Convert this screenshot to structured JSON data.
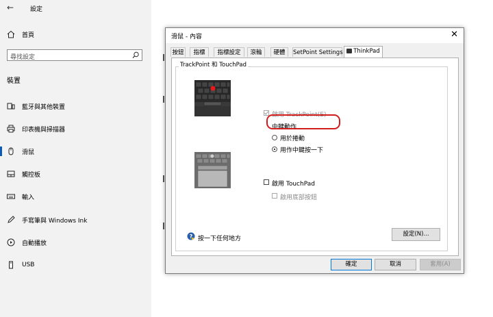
{
  "settings": {
    "window_title": "設定",
    "search": {
      "placeholder": "尋找設定"
    },
    "home_label": "首頁",
    "section_title": "裝置",
    "nav_items": [
      {
        "label": "藍牙與其他裝置",
        "icon": "bluetooth-devices-icon"
      },
      {
        "label": "印表機與掃描器",
        "icon": "printer-icon"
      },
      {
        "label": "滑鼠",
        "icon": "mouse-icon"
      },
      {
        "label": "觸控板",
        "icon": "touchpad-icon"
      },
      {
        "label": "輸入",
        "icon": "keyboard-icon"
      },
      {
        "label": "手寫筆與 Windows Ink",
        "icon": "pen-icon"
      },
      {
        "label": "自動播放",
        "icon": "autoplay-icon"
      },
      {
        "label": "USB",
        "icon": "usb-icon"
      }
    ],
    "active_index": 2,
    "accent_color": "#0a5bb5"
  },
  "dialog": {
    "title": "滑鼠 - 內容",
    "tabs": [
      "按鈕",
      "指標",
      "指標設定",
      "滾輪",
      "硬體",
      "SetPoint Settings",
      "ThinkPad"
    ],
    "active_tab": "ThinkPad",
    "group_label": "TrackPoint 和 TouchPad",
    "trackpoint": {
      "enable_label": "啟用 TrackPoint(E)",
      "middle_button_label": "中鍵動作",
      "option_scroll": "用於捲動",
      "option_middle_click": "用作中鍵按一下",
      "selected": "option_middle_click"
    },
    "touchpad": {
      "enable_label": "啟用 TouchPad",
      "bottom_buttons_label": "啟用底部按鈕"
    },
    "help_text": "按一下任何地方",
    "settings_button": "設定(N)...",
    "ok_button": "確定",
    "cancel_button": "取消",
    "apply_button": "套用(A)",
    "highlight_color": "#d21c1c"
  }
}
